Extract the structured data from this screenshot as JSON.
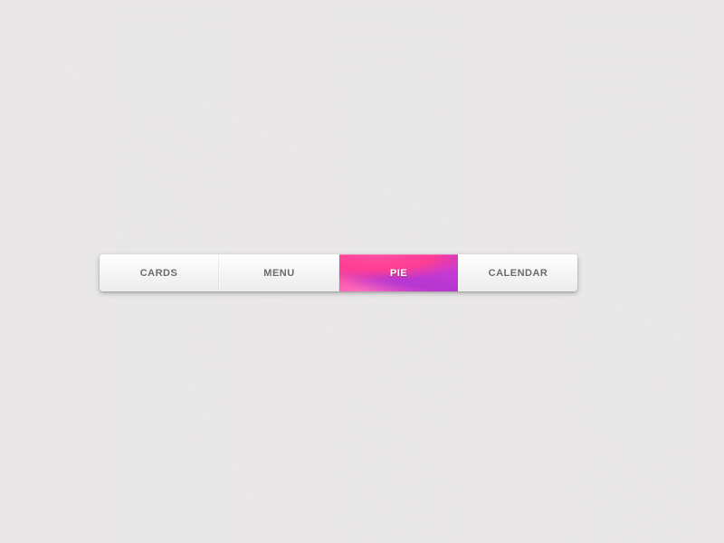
{
  "nav": {
    "items": [
      {
        "label": "CARDS"
      },
      {
        "label": "MENU"
      },
      {
        "label": "PIE"
      },
      {
        "label": "CALENDAR"
      }
    ],
    "active_index": 2
  },
  "colors": {
    "active_gradient_start": "#ff3d93",
    "active_gradient_end": "#a534ce",
    "text_inactive": "#6a6a6a",
    "text_active": "#ffffff",
    "background": "#ebe9e9"
  }
}
